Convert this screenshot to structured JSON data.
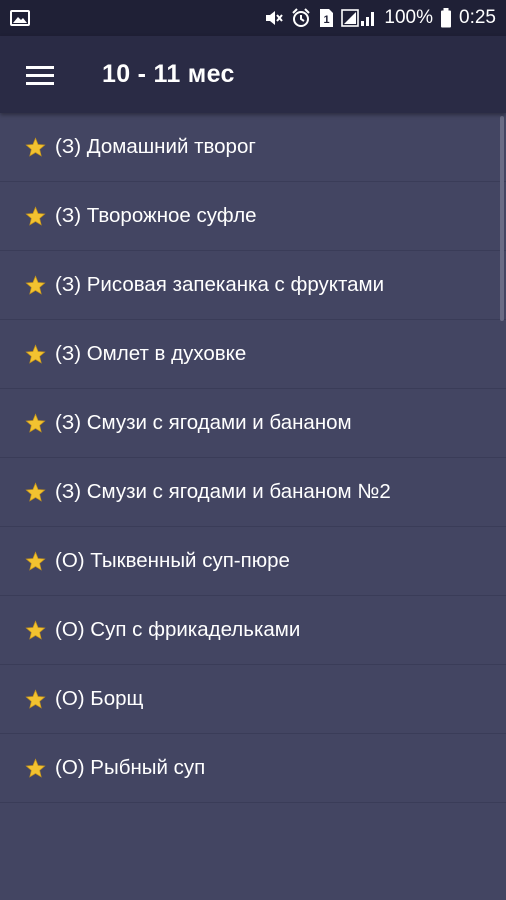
{
  "status_bar": {
    "battery": "100%",
    "time": "0:25",
    "sim_badge": "1",
    "icons": [
      "image-icon",
      "mute-icon",
      "alarm-icon",
      "sim-icon",
      "signal-icon",
      "battery-icon"
    ]
  },
  "app_bar": {
    "title": "10 - 11 мес",
    "menu_icon": "hamburger-menu-icon"
  },
  "colors": {
    "background": "#434562",
    "app_bar": "#2a2b45",
    "status_bar": "#1f2036",
    "star": "#f2c230"
  },
  "recipes": [
    {
      "label": "(З) Домашний творог"
    },
    {
      "label": "(З) Творожное суфле"
    },
    {
      "label": "(З) Рисовая запеканка с фруктами"
    },
    {
      "label": "(З) Омлет в духовке"
    },
    {
      "label": "(З) Смузи с ягодами и бананом"
    },
    {
      "label": "(З) Смузи с ягодами и бананом №2"
    },
    {
      "label": "(О) Тыквенный суп-пюре"
    },
    {
      "label": "(О) Суп с фрикадельками"
    },
    {
      "label": "(О) Борщ"
    },
    {
      "label": "(О) Рыбный суп"
    }
  ]
}
